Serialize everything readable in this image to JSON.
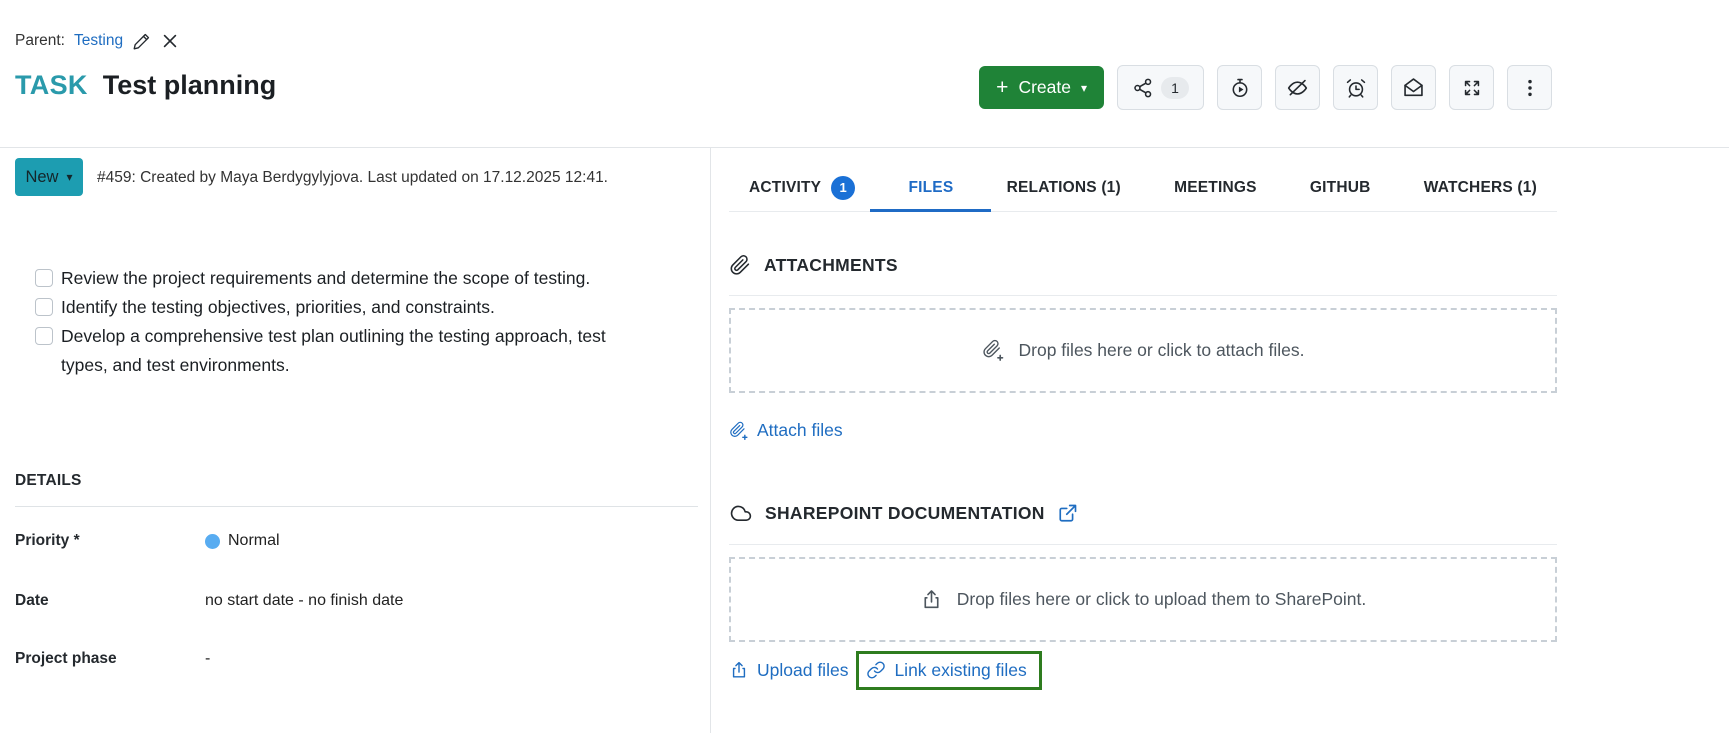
{
  "header": {
    "parent_label": "Parent:",
    "parent_name": "Testing",
    "type_label": "TASK",
    "title": "Test planning"
  },
  "toolbar": {
    "create_label": "Create",
    "share_count": "1"
  },
  "status": {
    "value": "New",
    "meta": "#459: Created by Maya Berdygylyjova. Last updated on 17.12.2025 12:41."
  },
  "description": {
    "checklist": [
      {
        "text": "Review the project requirements and determine the scope of testing.",
        "checked": false
      },
      {
        "text": "Identify the testing objectives, priorities, and constraints.",
        "checked": false
      },
      {
        "text": "Develop a comprehensive test plan outlining the testing approach, test types, and test environments.",
        "checked": false
      }
    ]
  },
  "details": {
    "heading": "DETAILS",
    "fields": [
      {
        "label": "Priority *",
        "value": "Normal"
      },
      {
        "label": "Date",
        "value": "no start date - no finish date"
      },
      {
        "label": "Project phase",
        "value": "-"
      }
    ]
  },
  "tabs": {
    "activity": {
      "label": "ACTIVITY",
      "badge": "1"
    },
    "files": {
      "label": "FILES"
    },
    "relations": {
      "label": "RELATIONS (1)"
    },
    "meetings": {
      "label": "MEETINGS"
    },
    "github": {
      "label": "GITHUB"
    },
    "watchers": {
      "label": "WATCHERS (1)"
    }
  },
  "attachments": {
    "heading": "ATTACHMENTS",
    "dropzone_text": "Drop files here or click to attach files.",
    "attach_files_label": "Attach files"
  },
  "sharepoint": {
    "heading": "SHAREPOINT DOCUMENTATION",
    "dropzone_text": "Drop files here or click to upload them to SharePoint.",
    "upload_files_label": "Upload files",
    "link_existing_label": "Link existing files"
  },
  "colors": {
    "teal_status": "#1d9db1",
    "teal_type": "#2a9aab",
    "link_blue": "#1f6dc1",
    "create_green": "#1f8337",
    "activity_badge_blue": "#1a70d6",
    "highlight_green": "#2e7c1f",
    "priority_dot_blue": "#58acf1"
  },
  "icons": {
    "edit": "pencil",
    "remove": "x-cross",
    "share": "share-network",
    "timer": "stopwatch-play",
    "unwatch": "eye-slash",
    "reminder": "alarm-clock",
    "notification": "open-envelope",
    "fullscreen": "expand-arrows",
    "more": "kebab-dots",
    "attachment": "paperclip",
    "attach_add": "paperclip-plus",
    "storage": "cloud",
    "open_external": "external-link",
    "upload": "upload-tray-arrow",
    "link_file": "chain-link",
    "dropdown": "caret-down"
  }
}
